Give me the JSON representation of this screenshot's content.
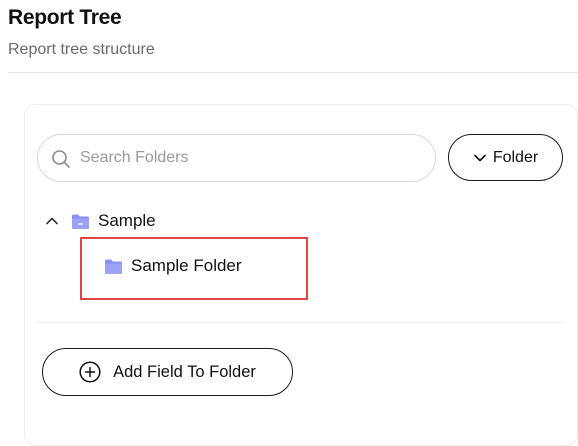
{
  "header": {
    "title": "Report Tree",
    "subtitle": "Report tree structure"
  },
  "search": {
    "placeholder": "Search Folders",
    "value": ""
  },
  "folder_button": {
    "label": "Folder",
    "icon": "chevron-down-icon"
  },
  "tree": {
    "root": {
      "label": "Sample",
      "expanded": true,
      "icon": "folder-icon",
      "children": [
        {
          "label": "Sample Folder",
          "icon": "folder-icon",
          "selected": true
        }
      ]
    }
  },
  "actions": {
    "add_field_label": "Add Field To Folder",
    "add_field_icon": "plus-circle-icon"
  },
  "colors": {
    "folder_icon": "#8b8ff0",
    "selection_border": "#e04545",
    "subtitle_text": "#6b6b6b",
    "placeholder_text": "#9a9a9a"
  }
}
